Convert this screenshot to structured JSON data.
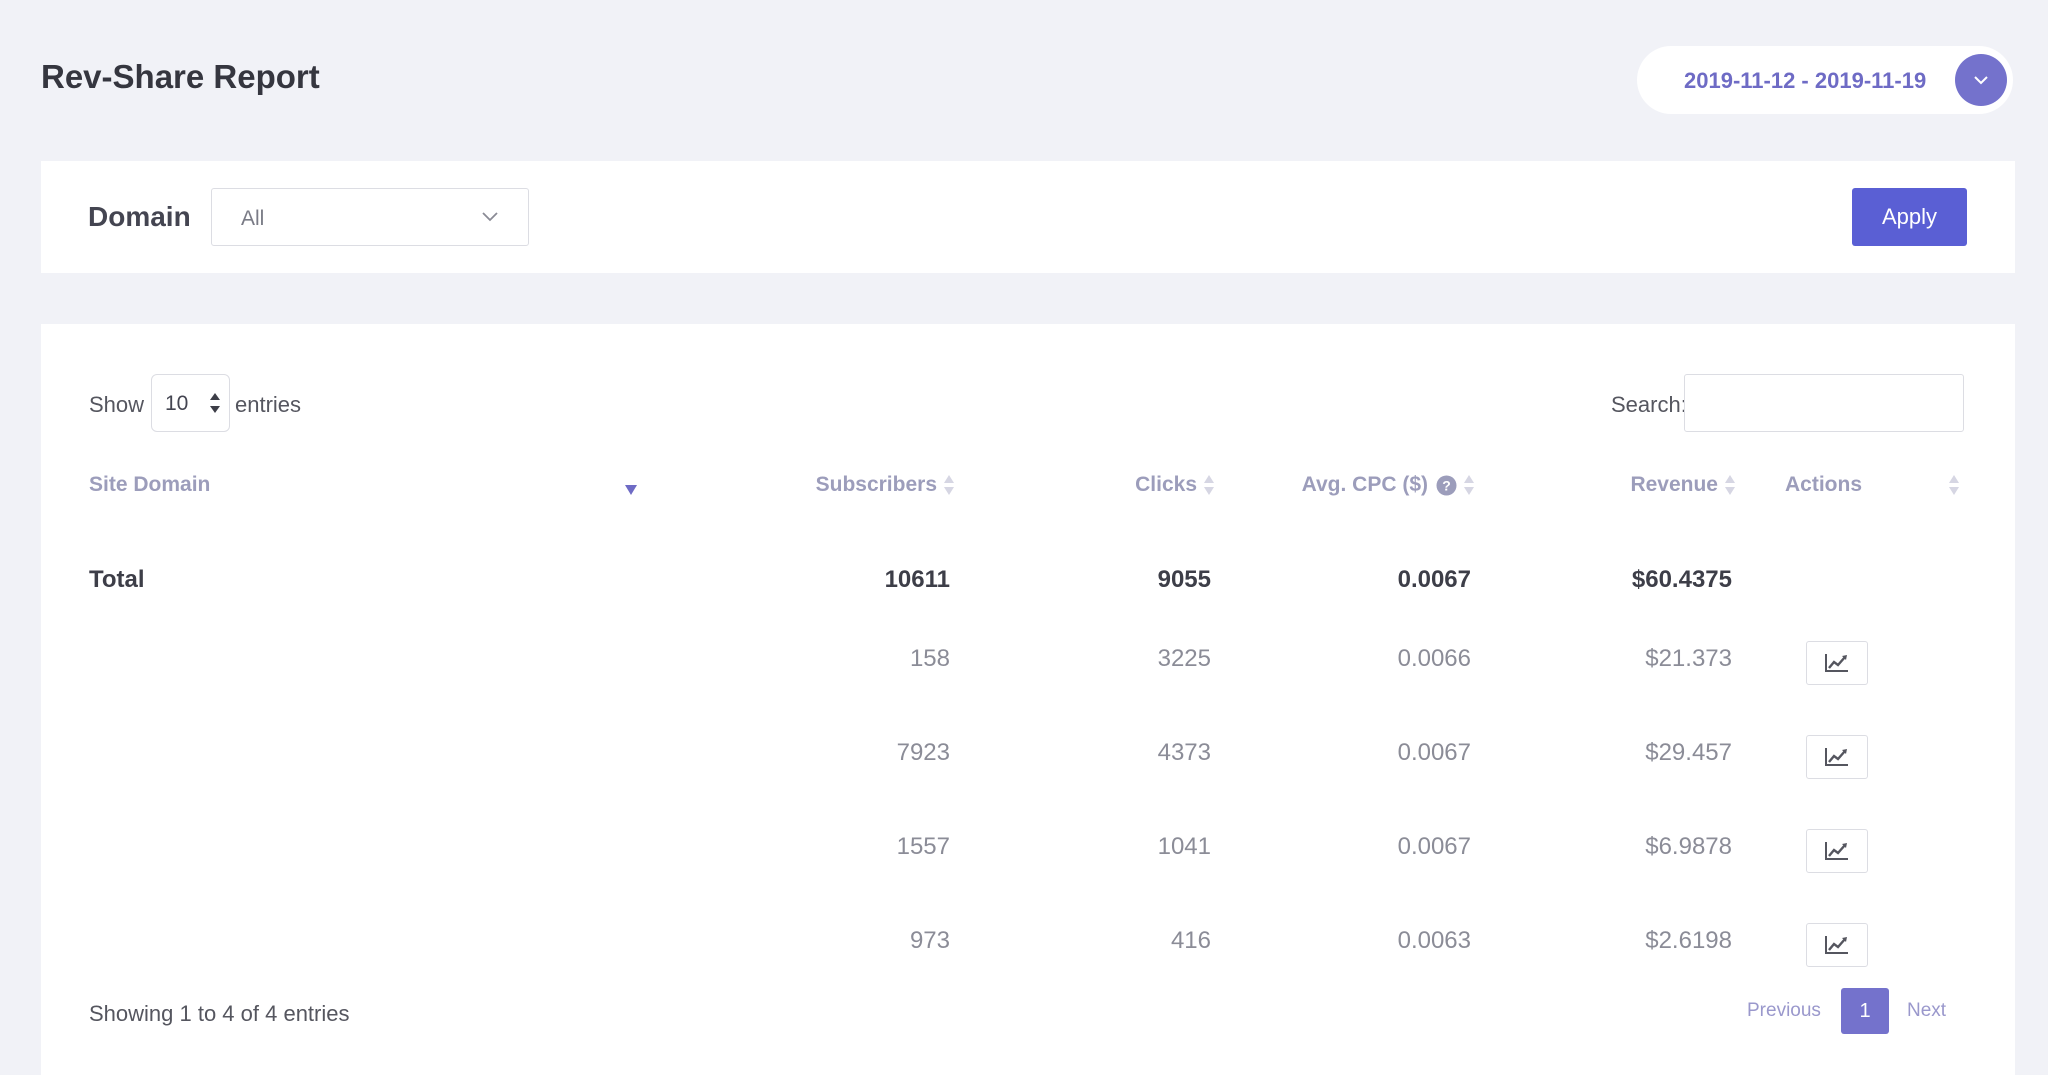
{
  "page": {
    "title": "Rev-Share Report"
  },
  "date_range": {
    "label": "2019-11-12 - 2019-11-19",
    "accent": "#7472cc"
  },
  "filter": {
    "label": "Domain",
    "domain_value": "All",
    "apply_label": "Apply",
    "apply_color": "#5a5fd4"
  },
  "table_controls": {
    "show_label": "Show",
    "length_value": "10",
    "entries_label": "entries",
    "search_label": "Search:",
    "search_value": ""
  },
  "columns": {
    "site_domain": "Site Domain",
    "subscribers": "Subscribers",
    "clicks": "Clicks",
    "avg_cpc": "Avg. CPC ($)",
    "revenue": "Revenue",
    "actions": "Actions"
  },
  "total": {
    "label": "Total",
    "subscribers": "10611",
    "clicks": "9055",
    "avg_cpc": "0.0067",
    "revenue": "$60.4375"
  },
  "rows": [
    {
      "site_domain": "",
      "subscribers": "158",
      "clicks": "3225",
      "avg_cpc": "0.0066",
      "revenue": "$21.373",
      "action_icon": "line-chart-icon"
    },
    {
      "site_domain": "",
      "subscribers": "7923",
      "clicks": "4373",
      "avg_cpc": "0.0067",
      "revenue": "$29.457",
      "action_icon": "line-chart-icon"
    },
    {
      "site_domain": "",
      "subscribers": "1557",
      "clicks": "1041",
      "avg_cpc": "0.0067",
      "revenue": "$6.9878",
      "action_icon": "line-chart-icon"
    },
    {
      "site_domain": "",
      "subscribers": "973",
      "clicks": "416",
      "avg_cpc": "0.0063",
      "revenue": "$2.6198",
      "action_icon": "line-chart-icon"
    }
  ],
  "footer": {
    "info": "Showing 1 to 4 of 4 entries",
    "previous_label": "Previous",
    "current_page": "1",
    "next_label": "Next"
  }
}
